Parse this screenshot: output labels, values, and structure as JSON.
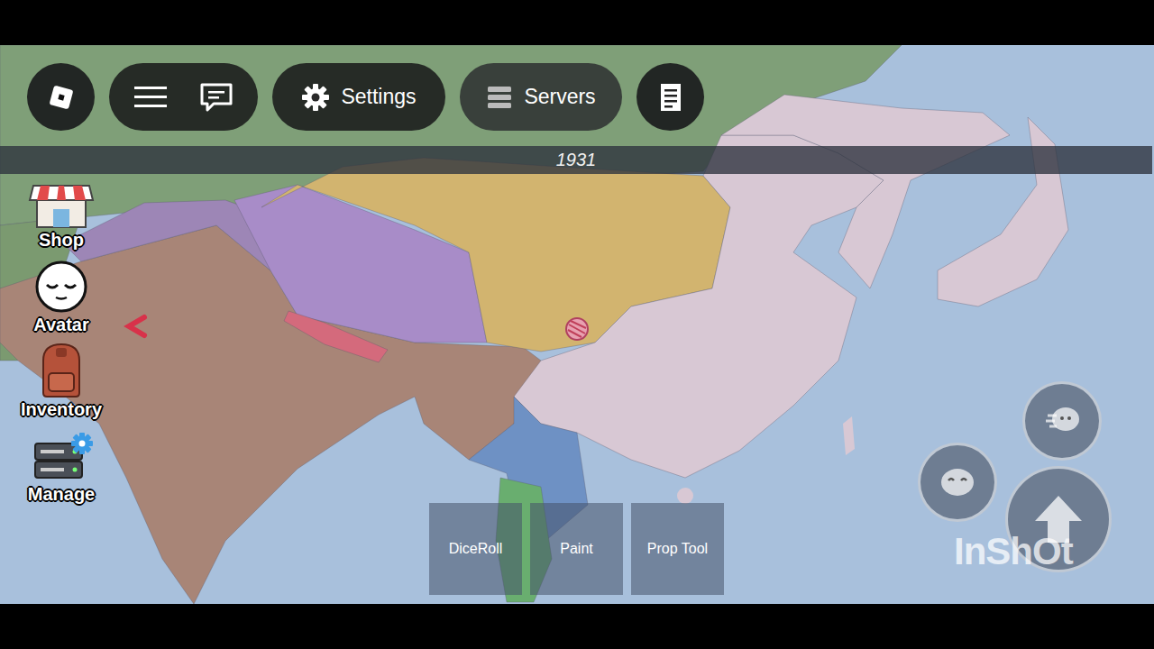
{
  "topbar": {
    "buttons": [
      {
        "label": "Settings"
      },
      {
        "label": "Servers"
      }
    ]
  },
  "year": "1931",
  "sidebar": {
    "items": [
      {
        "label": "Shop"
      },
      {
        "label": "Avatar"
      },
      {
        "label": "Inventory"
      },
      {
        "label": "Manage"
      }
    ]
  },
  "tools": [
    {
      "label": "DiceRoll"
    },
    {
      "label": "Paint"
    },
    {
      "label": "Prop Tool"
    }
  ],
  "map": {
    "regions": [
      {
        "color": "#7f9f78"
      },
      {
        "color": "#7b9a70"
      },
      {
        "color": "#a88577"
      },
      {
        "color": "#9d86b6"
      },
      {
        "color": "#a88cc8"
      },
      {
        "color": "#d46a7c"
      },
      {
        "color": "#d2b46f"
      },
      {
        "color": "#d8c8d4"
      },
      {
        "color": "#d8c8d4"
      },
      {
        "color": "#d8c8d4"
      },
      {
        "color": "#6e91c4"
      },
      {
        "color": "#69ae6f"
      }
    ]
  },
  "watermark": "InShOt"
}
